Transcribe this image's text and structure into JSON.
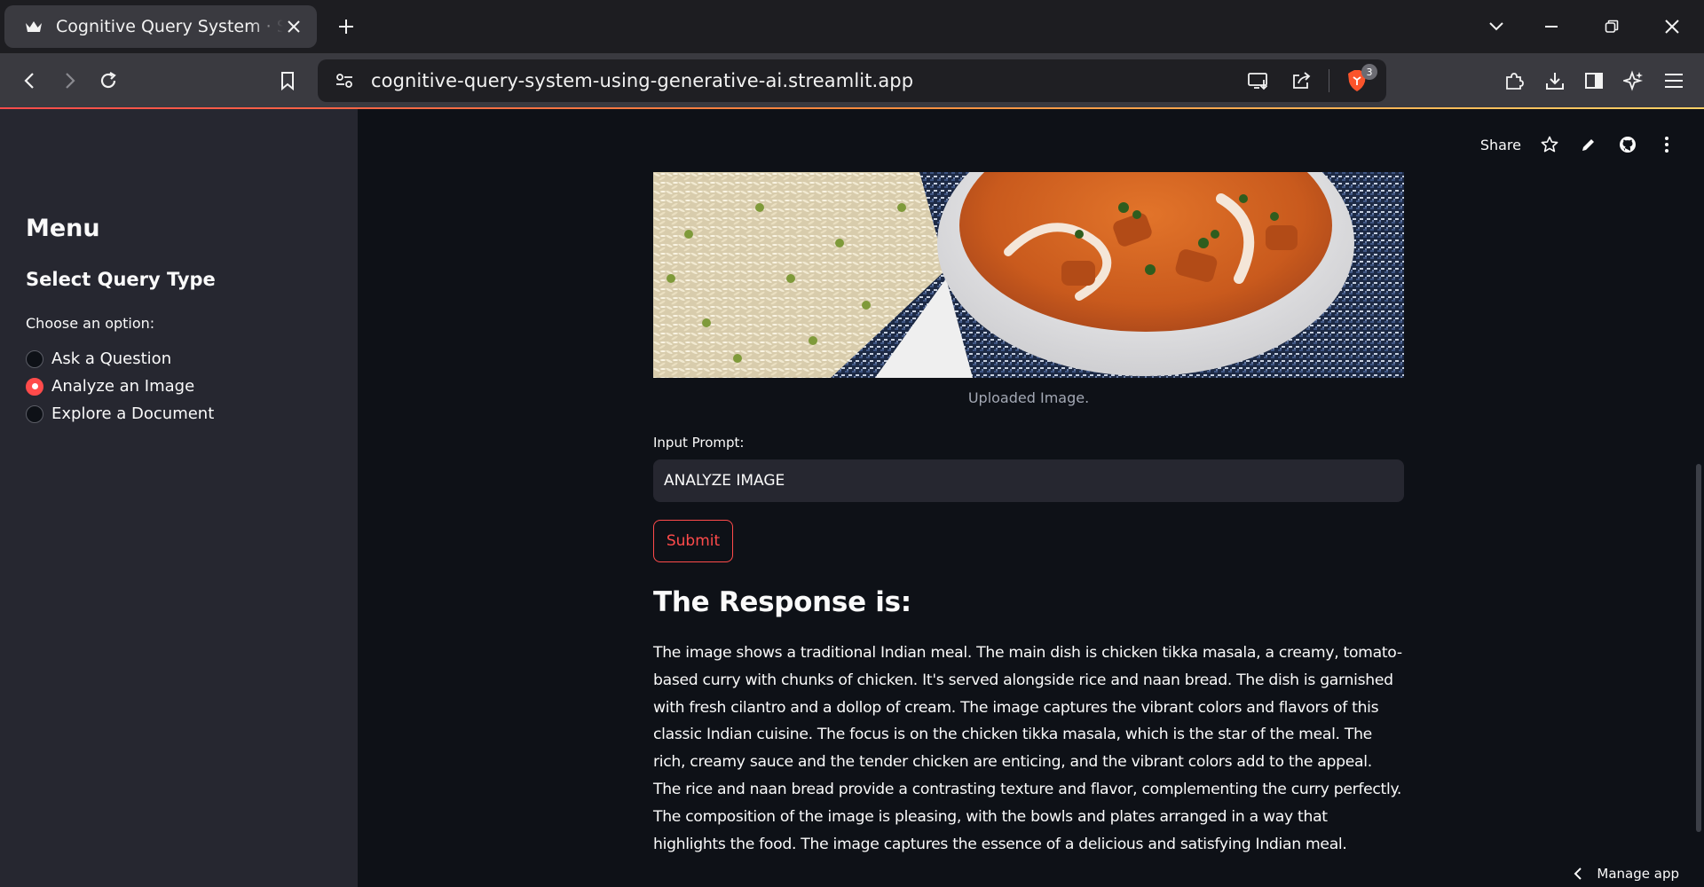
{
  "browser": {
    "tab_title": "Cognitive Query System · Streamlit",
    "url": "cognitive-query-system-using-generative-ai.streamlit.app",
    "shields_count": "3"
  },
  "sidebar": {
    "menu_title": "Menu",
    "section_title": "Select Query Type",
    "radio_label": "Choose an option:",
    "options": [
      {
        "label": "Ask a Question",
        "selected": false
      },
      {
        "label": "Analyze an Image",
        "selected": true
      },
      {
        "label": "Explore a Document",
        "selected": false
      }
    ]
  },
  "header": {
    "share_label": "Share"
  },
  "main": {
    "image_caption": "Uploaded Image.",
    "input_label": "Input Prompt:",
    "input_value": "ANALYZE IMAGE",
    "submit_label": "Submit",
    "response_heading": "The Response is:",
    "response_text": "The image shows a traditional Indian meal. The main dish is chicken tikka masala, a creamy, tomato-based curry with chunks of chicken. It's served alongside rice and naan bread. The dish is garnished with fresh cilantro and a dollop of cream. The image captures the vibrant colors and flavors of this classic Indian cuisine. The focus is on the chicken tikka masala, which is the star of the meal. The rich, creamy sauce and the tender chicken are enticing, and the vibrant colors add to the appeal. The rice and naan bread provide a contrasting texture and flavor, complementing the curry perfectly. The composition of the image is pleasing, with the bowls and plates arranged in a way that highlights the food. The image captures the essence of a delicious and satisfying Indian meal."
  },
  "footer": {
    "manage_app_label": "Manage app"
  },
  "colors": {
    "primary": "#ff4b4b",
    "background": "#0e1117",
    "sidebar_background": "#262730",
    "text": "#fafafa"
  }
}
